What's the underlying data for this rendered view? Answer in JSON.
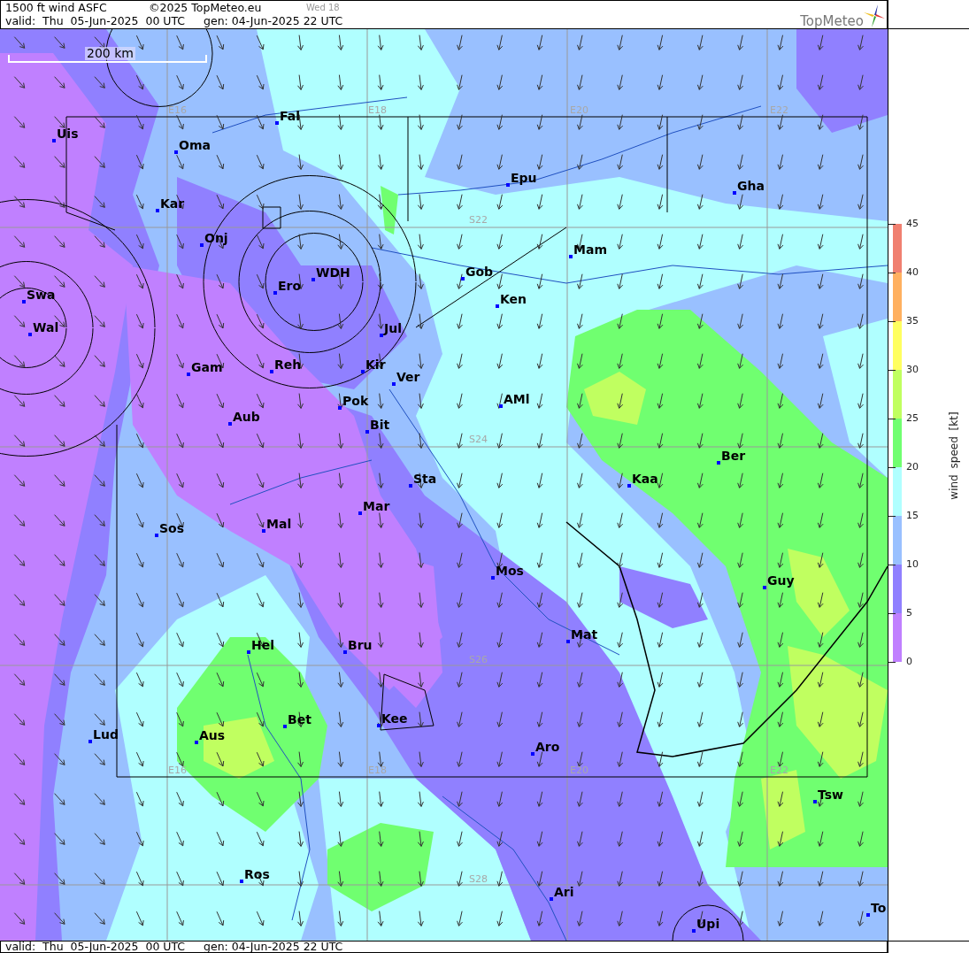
{
  "header": {
    "title": "1500 ft wind ASFC",
    "copyright": "©2025 TopMeteo.eu",
    "run_label": "Wed 18",
    "valid": "valid:  Thu  05-Jun-2025  00 UTC",
    "generated": "gen: 04-Jun-2025 22 UTC",
    "logo_text": "TopMeteo"
  },
  "map": {
    "scale_label": "200 km",
    "grid_labels": [
      "E16",
      "E18",
      "E20",
      "E22",
      "S22",
      "S24",
      "S26",
      "S28",
      "E16",
      "E18",
      "E20",
      "E22"
    ],
    "places": [
      {
        "name": "Uis"
      },
      {
        "name": "Oma"
      },
      {
        "name": "Fal"
      },
      {
        "name": "Kar"
      },
      {
        "name": "Onj"
      },
      {
        "name": "Swa"
      },
      {
        "name": "Wal"
      },
      {
        "name": "Ero"
      },
      {
        "name": "WDH"
      },
      {
        "name": "Gob"
      },
      {
        "name": "Mam"
      },
      {
        "name": "Ken"
      },
      {
        "name": "Epu"
      },
      {
        "name": "Gha"
      },
      {
        "name": "Jul"
      },
      {
        "name": "Gam"
      },
      {
        "name": "Reh"
      },
      {
        "name": "Kir"
      },
      {
        "name": "Ver"
      },
      {
        "name": "Pok"
      },
      {
        "name": "Bit"
      },
      {
        "name": "AMl"
      },
      {
        "name": "Aub"
      },
      {
        "name": "Ber"
      },
      {
        "name": "Kaa"
      },
      {
        "name": "Sta"
      },
      {
        "name": "Mar"
      },
      {
        "name": "Sos"
      },
      {
        "name": "Mal"
      },
      {
        "name": "Mos"
      },
      {
        "name": "Guy"
      },
      {
        "name": "Mat"
      },
      {
        "name": "Hel"
      },
      {
        "name": "Bru"
      },
      {
        "name": "Bet"
      },
      {
        "name": "Kee"
      },
      {
        "name": "Aus"
      },
      {
        "name": "Lud"
      },
      {
        "name": "Aro"
      },
      {
        "name": "Tsw"
      },
      {
        "name": "Ros"
      },
      {
        "name": "Ari"
      },
      {
        "name": "Upi"
      },
      {
        "name": "To"
      }
    ]
  },
  "legend": {
    "title": "wind speed [kt]",
    "ticks": [
      "45",
      "40",
      "35",
      "30",
      "25",
      "20",
      "15",
      "10",
      "5",
      "0"
    ],
    "bands": [
      {
        "color": "#f08070"
      },
      {
        "color": "#ffb060"
      },
      {
        "color": "#ffff60"
      },
      {
        "color": "#c0ff60"
      },
      {
        "color": "#70ff70"
      },
      {
        "color": "#b0ffff"
      },
      {
        "color": "#99c0ff"
      },
      {
        "color": "#9080ff"
      },
      {
        "color": "#c080ff"
      }
    ]
  },
  "footer": {
    "valid": "valid:  Thu  05-Jun-2025  00 UTC",
    "generated": "gen: 04-Jun-2025 22 UTC"
  }
}
